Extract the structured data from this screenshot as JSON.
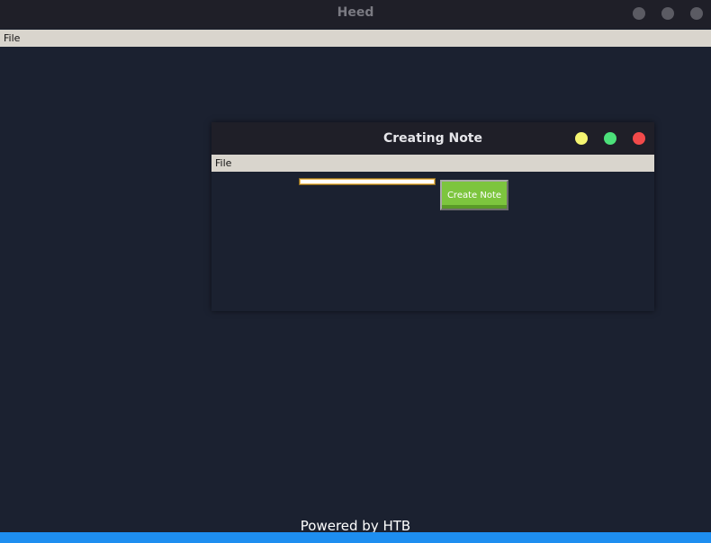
{
  "app": {
    "title": "Heed",
    "menu": [
      "File"
    ]
  },
  "dialog": {
    "title": "Creating Note",
    "menu": [
      "File"
    ],
    "input_value": "",
    "input_placeholder": "",
    "create_button_label": "Create Note",
    "colors": {
      "minimize": "#f5f571",
      "maximize": "#4ce07a",
      "close": "#f24a4a",
      "button": "#7dc53e"
    }
  },
  "footer": {
    "text": "Powered by HTB",
    "bar_color": "#1e8ef0"
  }
}
